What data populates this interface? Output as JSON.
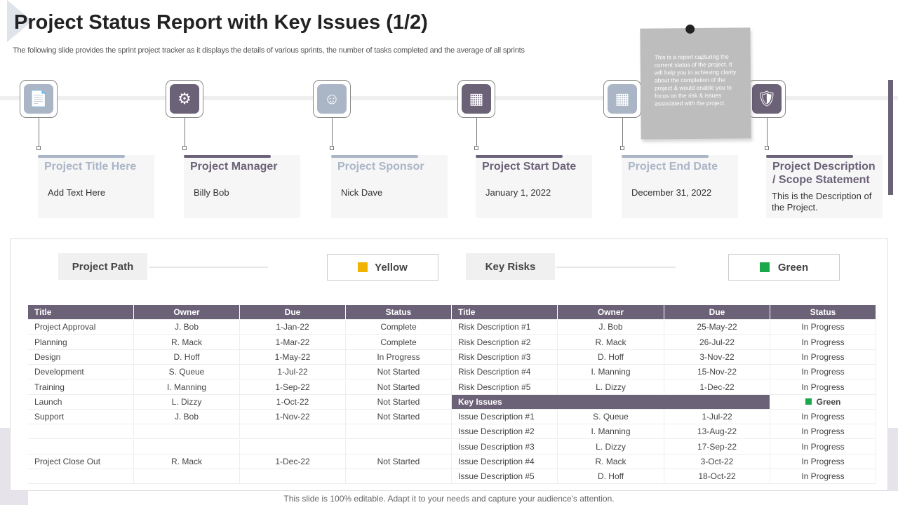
{
  "header": {
    "title": "Project Status Report with Key Issues (1/2)",
    "subtitle": "The following slide provides the sprint project tracker as it displays the details of various sprints, the number of tasks completed and the average of all sprints"
  },
  "note": {
    "text": "This is a report capturing the current status of the project. It will help you in achieving clarity about the completion of the project & would enable you to focus on the risk & issues associated with the project"
  },
  "cards": [
    {
      "heading": "Project Title Here",
      "value": "Add Text Here",
      "icon": "document-icon",
      "style": "light"
    },
    {
      "heading": "Project Manager",
      "value": "Billy Bob",
      "icon": "gear-person-icon",
      "style": "dark"
    },
    {
      "heading": "Project Sponsor",
      "value": "Nick Dave",
      "icon": "team-globe-icon",
      "style": "light"
    },
    {
      "heading": "Project Start Date",
      "value": "January  1, 2022",
      "icon": "calendar-icon",
      "style": "dark"
    },
    {
      "heading": "Project End Date",
      "value": "December  31, 2022",
      "icon": "calendar-icon",
      "style": "light"
    },
    {
      "heading": "Project Description / Scope Statement",
      "value": "This is the Description of the Project.",
      "icon": "budget-shield-icon",
      "style": "dark"
    }
  ],
  "status": {
    "path_label": "Project Path",
    "path_value": "Yellow",
    "path_color": "#f0b400",
    "risks_label": "Key Risks",
    "risks_value": "Green",
    "risks_color": "#1aa84a"
  },
  "table": {
    "left_headers": [
      "Title",
      "Owner",
      "Due",
      "Status"
    ],
    "right_headers": [
      "Title",
      "Owner",
      "Due",
      "Status"
    ],
    "left_rows": [
      [
        "Project Approval",
        "J. Bob",
        "1-Jan-22",
        "Complete"
      ],
      [
        "Planning",
        "R. Mack",
        "1-Mar-22",
        "Complete"
      ],
      [
        "Design",
        "D. Hoff",
        "1-May-22",
        "In Progress"
      ],
      [
        "Development",
        "S. Queue",
        "1-Jul-22",
        "Not Started"
      ],
      [
        "Training",
        "I. Manning",
        "1-Sep-22",
        "Not Started"
      ],
      [
        "Launch",
        "L. Dizzy",
        "1-Oct-22",
        "Not Started"
      ],
      [
        "Support",
        "J. Bob",
        "1-Nov-22",
        "Not Started"
      ],
      [
        "",
        "",
        "",
        ""
      ],
      [
        "",
        "",
        "",
        ""
      ],
      [
        "Project Close Out",
        "R. Mack",
        "1-Dec-22",
        "Not Started"
      ],
      [
        "",
        "",
        "",
        ""
      ]
    ],
    "risk_rows": [
      [
        "Risk Description #1",
        "J. Bob",
        "25-May-22",
        "In Progress"
      ],
      [
        "Risk Description #2",
        "R. Mack",
        "26-Jul-22",
        "In Progress"
      ],
      [
        "Risk Description #3",
        "D. Hoff",
        "3-Nov-22",
        "In Progress"
      ],
      [
        "Risk Description #4",
        "I. Manning",
        "15-Nov-22",
        "In Progress"
      ],
      [
        "Risk Description #5",
        "L. Dizzy",
        "1-Dec-22",
        "In Progress"
      ]
    ],
    "key_issues_label": "Key Issues",
    "key_issues_status": "Green",
    "key_issues_color": "#1aa84a",
    "issue_rows": [
      [
        "Issue Description #1",
        "S. Queue",
        "1-Jul-22",
        "In Progress"
      ],
      [
        "Issue Description #2",
        "I. Manning",
        "13-Aug-22",
        "In Progress"
      ],
      [
        "Issue Description #3",
        "L. Dizzy",
        "17-Sep-22",
        "In Progress"
      ],
      [
        "Issue Description #4",
        "R. Mack",
        "3-Oct-22",
        "In Progress"
      ],
      [
        "Issue Description #5",
        "D. Hoff",
        "18-Oct-22",
        "In Progress"
      ]
    ]
  },
  "footer": "This slide is 100% editable. Adapt it to your needs and capture your audience's attention.",
  "colors": {
    "dark": "#6c6278",
    "light": "#aab5c6"
  }
}
